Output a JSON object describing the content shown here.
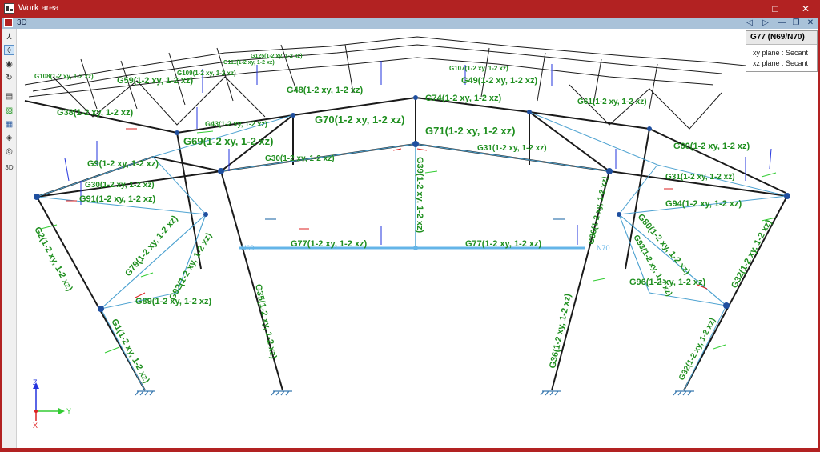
{
  "window": {
    "title": "Work area",
    "minimize_glyph": "□",
    "close_glyph": "✕"
  },
  "view": {
    "label": "3D"
  },
  "toolbar_icons": [
    "axes-icon",
    "shield-icon",
    "eye-view-icon",
    "rotate-icon",
    "layers-icon",
    "green-panel-icon",
    "grid-panel-icon",
    "cube-icon",
    "eye-icon",
    "3d-view-icon"
  ],
  "info_panel": {
    "title": "G77 (N69/N70)",
    "line1": "xy plane : Secant",
    "line2": "xz plane : Secant"
  },
  "axes": {
    "z": "Z",
    "y": "Y",
    "x": "X"
  },
  "nodes": {
    "left": "N69",
    "right": "N70"
  },
  "beam_labels": {
    "g108": "G108(1-2 xy, 1-2 xz)",
    "g109": "G109(1-2 xy, 1-2 xz)",
    "g111": "G111(1-2 xy, 1-2 xz)",
    "g125": "G125(1-2 xy, 1-2 xz)",
    "g107": "G107(1-2 xy, 1-2 xz)",
    "g59": "G59(1-2 xy, 1-2 xz)",
    "g48": "G48(1-2 xy, 1-2 xz)",
    "g49": "G49(1-2 xy, 1-2 xz)",
    "g38": "G38(1-2 xy, 1-2 xz)",
    "g43": "G43(1-2 xy, 1-2 xz)",
    "g61": "G61(1-2 xy, 1-2 xz)",
    "g74": "G74(1-2 xy, 1-2 xz)",
    "g69": "G69(1-2 xy, 1-2 xz)",
    "g70": "G70(1-2 xy, 1-2 xz)",
    "g71": "G71(1-2 xy, 1-2 xz)",
    "g9": "G9(1-2 xy, 1-2 xz)",
    "g30a": "G30(1-2 xy, 1-2 xz)",
    "g30b": "G30(1-2 xy, 1-2 xz)",
    "g31a": "G31(1-2 xy, 1-2 xz)",
    "g31b": "G31(1-2 xy, 1-2 xz)",
    "g60": "G60(1-2 xy, 1-2 xz)",
    "g91": "G91(1-2 xy, 1-2 xz)",
    "g94": "G94(1-2 xy, 1-2 xz)",
    "g39": "G39(1-2 xy, 1-2 xz)",
    "g77a": "G77(1-2 xy, 1-2 xz)",
    "g77b": "G77(1-2 xy, 1-2 xz)",
    "g79": "G79(1-2 xy, 1-2 xz)",
    "g80": "G80(1-2 xy, 1-2 xz)",
    "g89": "G89(1-2 xy, 1-2 xz)",
    "g96": "G96(1-2 xy, 1-2 xz)",
    "g92": "G92(1-2 xy, 1-2 xz)",
    "g93": "G93(1-2 xy, 1-2 xz)",
    "g35": "G35(1-2 xy, 1-2 xz)",
    "g36a": "G36(1-2 xy, 1-2 xz)",
    "g36b": "G36(1-2 xy, 1-2 xz)",
    "g32": "G32(1-2 xy, 1-2 xz)",
    "g32b": "G32(1-2 xy, 1-2 xz)",
    "g2": "G2(1-2 xy, 1-2 xz)",
    "g1": "G1(1-2 xy, 1-2 xz)"
  },
  "colors": {
    "window_frame": "#b22222",
    "member_black": "#1a1a1a",
    "member_blue": "#4fa3d1",
    "selected": "#64b5e8",
    "label_green": "#1f8f1f",
    "arrow_blue": "#2233dd",
    "arrow_green": "#33cc33",
    "arrow_red": "#dd2222",
    "node": "#1f4f9f"
  }
}
